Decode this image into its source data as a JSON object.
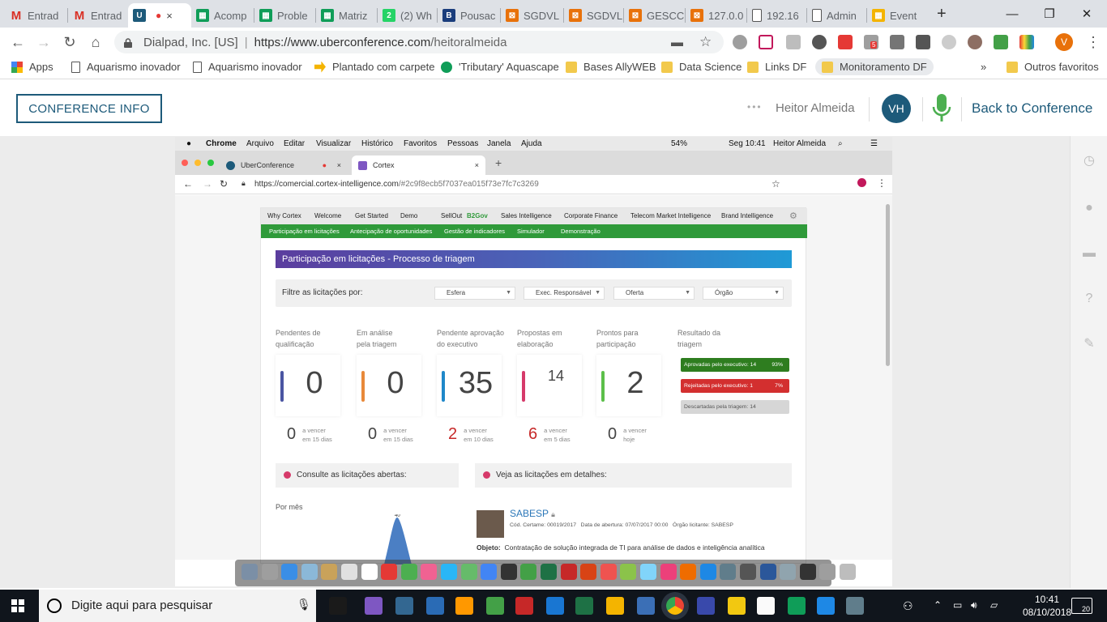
{
  "browser": {
    "tabs": [
      {
        "label": "Entrad",
        "fav": "gmail-icon",
        "color": "#d93025",
        "glyph": "M"
      },
      {
        "label": "Entrad",
        "fav": "gmail-icon",
        "color": "#d93025",
        "glyph": "M"
      },
      {
        "label": "",
        "fav": "uberconference-icon",
        "color": "#1d5a7a",
        "glyph": "U",
        "active": true
      },
      {
        "label": "Acomp",
        "fav": "sheets-icon",
        "color": "#0f9d58",
        "glyph": "▦"
      },
      {
        "label": "Proble",
        "fav": "sheets-icon",
        "color": "#0f9d58",
        "glyph": "▦"
      },
      {
        "label": "Matriz",
        "fav": "sheets-icon",
        "color": "#0f9d58",
        "glyph": "▦"
      },
      {
        "label": "(2) Wh",
        "fav": "whatsapp-icon",
        "color": "#25d366",
        "glyph": "2"
      },
      {
        "label": "Pousac",
        "fav": "b-icon",
        "color": "#1a3d7c",
        "glyph": "B"
      },
      {
        "label": "SGDVL",
        "fav": "sgdv-icon",
        "color": "#e8710a",
        "glyph": "⊠"
      },
      {
        "label": "SGDVL",
        "fav": "sgdv-icon",
        "color": "#e8710a",
        "glyph": "⊠"
      },
      {
        "label": "GESCC",
        "fav": "sgdv-icon",
        "color": "#e8710a",
        "glyph": "⊠"
      },
      {
        "label": "127.0.0",
        "fav": "sgdv-icon",
        "color": "#e8710a",
        "glyph": "⊠"
      },
      {
        "label": "192.16",
        "fav": "page-icon",
        "color": "#ffffff",
        "glyph": ""
      },
      {
        "label": "Admin",
        "fav": "page-icon",
        "color": "#ffffff",
        "glyph": ""
      },
      {
        "label": "Event",
        "fav": "grid-icon",
        "color": "#f4b400",
        "glyph": "▦"
      }
    ],
    "omnibox": {
      "site": "Dialpad, Inc. [US]",
      "url_host": "https://www.uberconference.com",
      "url_path": "/heitoralmeida"
    },
    "profile_initial": "V",
    "badge_count": "5",
    "bookmarks": [
      {
        "label": "Apps",
        "icon": "apps-grid-icon"
      },
      {
        "label": "Aquarismo inovador",
        "icon": "page-icon"
      },
      {
        "label": "Aquarismo inovador",
        "icon": "page-icon"
      },
      {
        "label": "Plantado com carpete",
        "icon": "arrow-icon"
      },
      {
        "label": "'Tributary' Aquascape",
        "icon": "green-dot-icon"
      },
      {
        "label": "Bases AllyWEB",
        "icon": "folder-icon"
      },
      {
        "label": "Data Science",
        "icon": "folder-icon"
      },
      {
        "label": "Links DF",
        "icon": "folder-icon"
      },
      {
        "label": "Monitoramento DF",
        "icon": "folder-icon"
      },
      {
        "label": "Outros favoritos",
        "icon": "folder-icon"
      }
    ],
    "more_chevron": "»"
  },
  "uc": {
    "conference_info": "CONFERENCE INFO",
    "user_name": "Heitor Almeida",
    "avatar_initials": "VH",
    "back_label": "Back to Conference",
    "colors": {
      "brand": "#1d5a7a",
      "mic": "#4caf50"
    }
  },
  "mac": {
    "menu": [
      "Chrome",
      "Arquivo",
      "Editar",
      "Visualizar",
      "Histórico",
      "Favoritos",
      "Pessoas",
      "Janela",
      "Ajuda"
    ],
    "battery": "54%",
    "clock": "Seg 10:41",
    "user": "Heitor Almeida",
    "tabs": [
      {
        "label": "UberConference"
      },
      {
        "label": "Cortex"
      }
    ],
    "url_host": "https://comercial.cortex-intelligence.com",
    "url_path": "/#2c9f8ecb5f7037ea015f73e7fc7c3269"
  },
  "cortex": {
    "nav_top": [
      "Why Cortex",
      "Welcome",
      "Get Started",
      "Demo",
      "SellOut",
      "B2Gov",
      "Sales Intelligence",
      "Corporate Finance",
      "Telecom Market Intelligence",
      "Brand Intelligence"
    ],
    "nav_sub": [
      "Participação em licitações",
      "Antecipação de oportunidades",
      "Gestão de indicadores",
      "Simulador",
      "Demonstração"
    ],
    "title": "Participação em licitações - Processo de triagem",
    "filter_label": "Filtre as licitações por:",
    "filters": [
      "Esfera",
      "Exec. Responsável",
      "Oferta",
      "Órgão"
    ],
    "stats": [
      {
        "label1": "Pendentes de",
        "label2": "qualificação",
        "value": "0",
        "sub_value": "0",
        "sub_1": "a vencer",
        "sub_2": "em 15 dias",
        "color": "#4a55a2",
        "sub_color": "#444"
      },
      {
        "label1": "Em análise",
        "label2": "pela triagem",
        "value": "0",
        "sub_value": "0",
        "sub_1": "a vencer",
        "sub_2": "em 15 dias",
        "color": "#e8893a",
        "sub_color": "#444"
      },
      {
        "label1": "Pendente aprovação",
        "label2": "do executivo",
        "value": "35",
        "sub_value": "2",
        "sub_1": "a vencer",
        "sub_2": "em 10 dias",
        "color": "#1f88c9",
        "sub_color": "#c62828"
      },
      {
        "label1": "Propostas em",
        "label2": "elaboração",
        "value": "14",
        "sub_value": "6",
        "sub_1": "a vencer",
        "sub_2": "em 5 dias",
        "color": "#d63a6a",
        "sub_color": "#c62828"
      },
      {
        "label1": "Prontos para",
        "label2": "participação",
        "value": "2",
        "sub_value": "0",
        "sub_1": "a vencer",
        "sub_2": "hoje",
        "color": "#5cbf4a",
        "sub_color": "#444"
      }
    ],
    "result_label1": "Resultado da",
    "result_label2": "triagem",
    "results": [
      {
        "label": "Aprovadas pelo executivo: 14",
        "pct": "93%",
        "color": "#2e7d1f"
      },
      {
        "label": "Rejeitadas pelo executivo: 1",
        "pct": "7%",
        "color": "#d32f2f"
      },
      {
        "label": "Descartadas pela triagem: 14",
        "pct": "",
        "color": "#d6d6d6"
      }
    ],
    "section_left": "Consulte as licitações abertas:",
    "section_right": "Veja as licitações em detalhes:",
    "por_mes": "Por mês",
    "peak_label": "40",
    "sabesp": {
      "name": "SABESP",
      "cod": "Cód. Certame: 00019/2017",
      "data": "Data de abertura: 07/07/2017 00:00",
      "orgao": "Órgão licitante: SABESP",
      "obj_label": "Objeto:",
      "obj_text": "Contratação de solução integrada de TI para análise de dados e inteligência analítica"
    }
  },
  "taskbar": {
    "search_placeholder": "Digite aqui para pesquisar",
    "time": "10:41",
    "date": "08/10/2018",
    "notifications": "20"
  }
}
